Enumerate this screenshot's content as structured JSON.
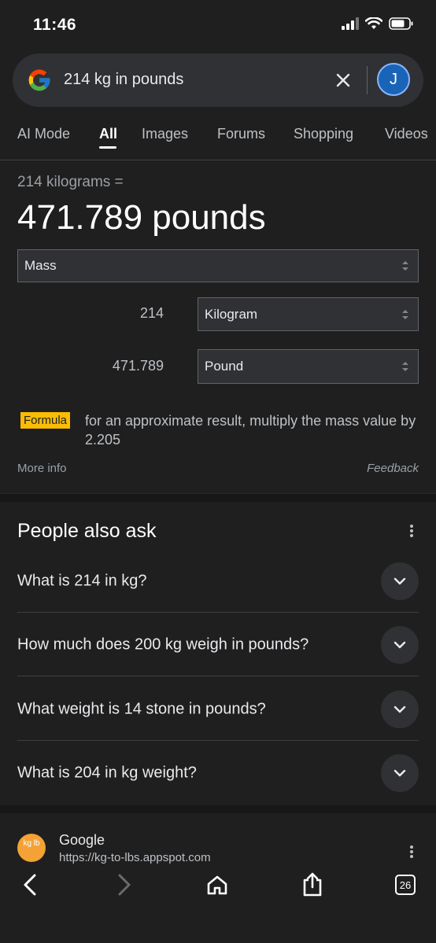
{
  "status": {
    "time": "11:46"
  },
  "search": {
    "query": "214 kg in pounds",
    "avatar_letter": "J"
  },
  "tabs": [
    {
      "label": "AI Mode"
    },
    {
      "label": "All"
    },
    {
      "label": "Images"
    },
    {
      "label": "Forums"
    },
    {
      "label": "Shopping"
    },
    {
      "label": "Videos"
    }
  ],
  "converter": {
    "query_text": "214 kilograms =",
    "result_text": "471.789 pounds",
    "category": "Mass",
    "from_value": "214",
    "from_unit": "Kilogram",
    "to_value": "471.789",
    "to_unit": "Pound",
    "formula_label": "Formula",
    "formula_text": "for an approximate result, multiply the mass value by 2.205",
    "more_info": "More info",
    "feedback": "Feedback"
  },
  "people_also_ask": {
    "title": "People also ask",
    "questions": [
      "What is 214 in kg?",
      "How much does 200 kg weigh in pounds?",
      "What weight is 14 stone in pounds?",
      "What is 204 in kg weight?"
    ]
  },
  "result": {
    "favicon_text": "kg lb",
    "site": "Google",
    "url": "https://kg-to-lbs.appspot.com"
  },
  "bottom_bar": {
    "tab_count": "26"
  },
  "colors": {
    "accent_badge": "#fbbc04",
    "avatar_bg": "#1a64b8",
    "background": "#1f1f1f"
  }
}
